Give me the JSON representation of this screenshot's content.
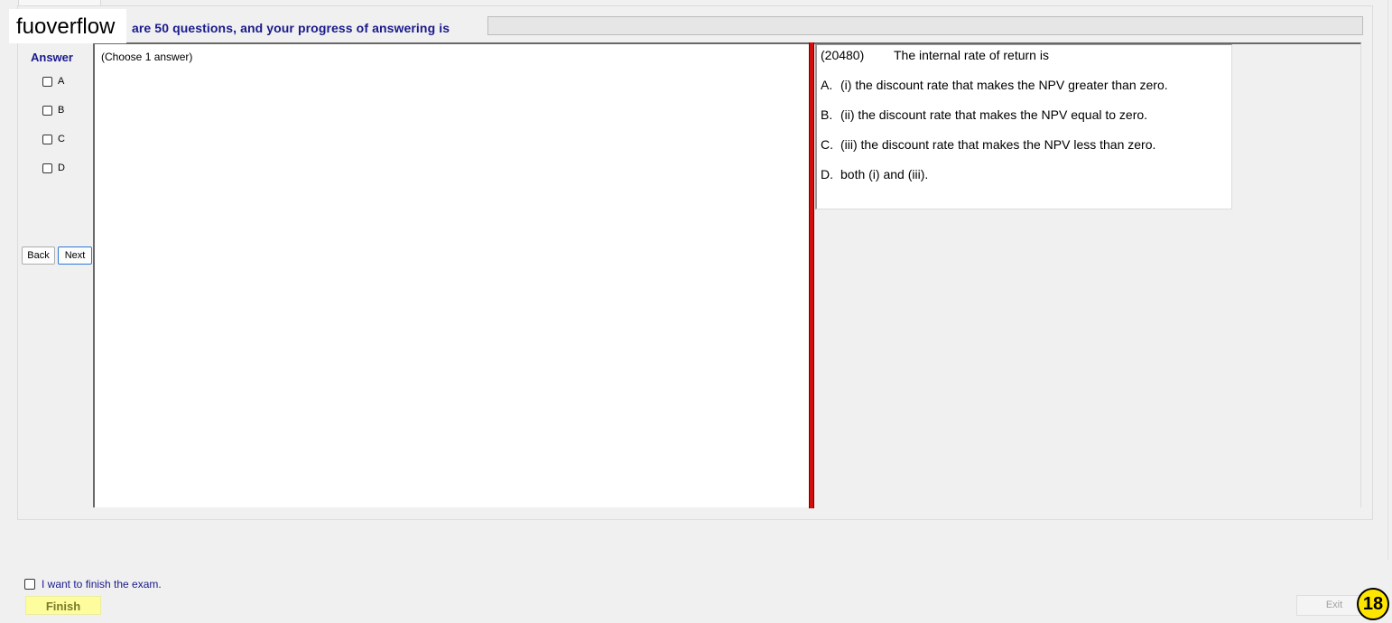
{
  "watermark": "fuoverflow",
  "progress": {
    "label": "are 50 questions, and your progress of answering is",
    "value_percent": 0,
    "color": "#06b025"
  },
  "answer": {
    "heading": "Answer",
    "options": [
      "A",
      "B",
      "C",
      "D"
    ],
    "back_label": "Back",
    "next_label": "Next",
    "hint": "(Choose 1 answer)"
  },
  "question": {
    "id": "(20480)",
    "text": "The internal rate of return is",
    "options": [
      {
        "letter": "A.",
        "text": "(i) the discount rate that makes the NPV greater than zero."
      },
      {
        "letter": "B.",
        "text": "(ii) the discount rate that makes the NPV equal to zero."
      },
      {
        "letter": "C.",
        "text": "(iii) the discount rate that makes the NPV less than zero."
      },
      {
        "letter": "D.",
        "text": "both (i) and (iii)."
      }
    ]
  },
  "footer": {
    "finish_checkbox_label": "I want to finish the exam.",
    "finish_label": "Finish",
    "exit_label": "Exit",
    "page_badge": "18"
  },
  "colors": {
    "splitter": "#d40d0d",
    "label_blue": "#1a1a8c",
    "finish_bg": "#fdfd9e",
    "badge": "#ffe600"
  }
}
